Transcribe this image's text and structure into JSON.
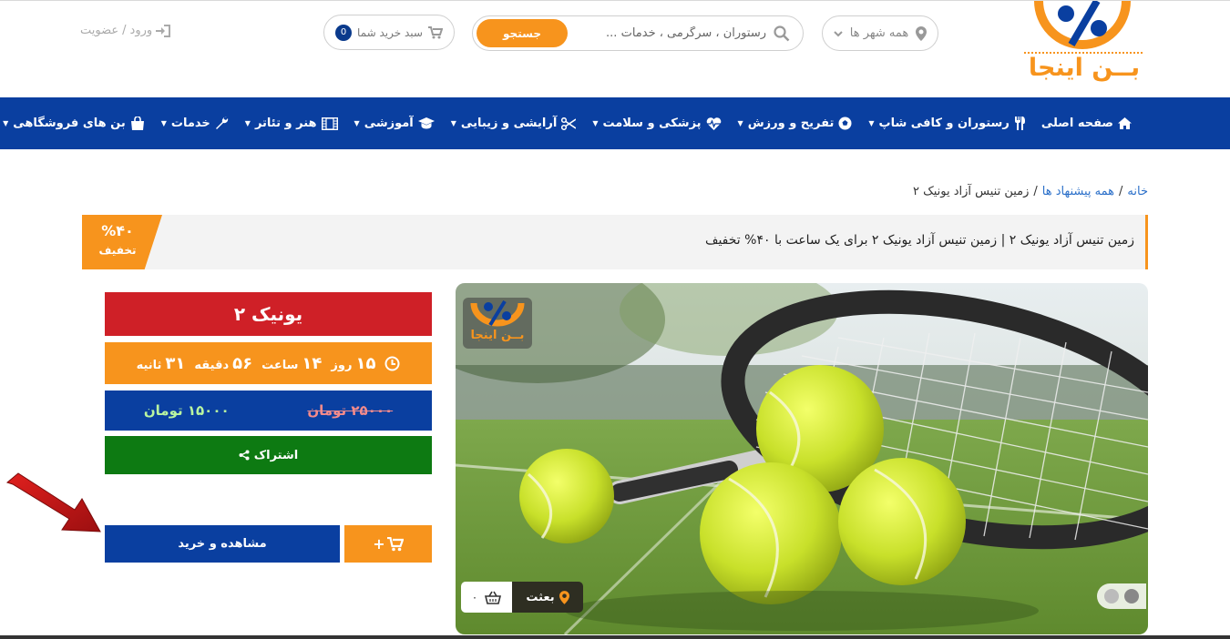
{
  "brand": {
    "name": "بــن اینجا",
    "accent": "#f7941d",
    "primary": "#0a3fa0"
  },
  "header": {
    "city_select": "همه شهر ها",
    "search_placeholder": "رستوران ، سرگرمی ، خدمات ...",
    "search_button": "جستجو",
    "cart_label": "سبد خرید شما",
    "cart_count": "0",
    "login_label": "ورود",
    "register_label": "عضویت"
  },
  "nav": {
    "items": [
      {
        "label": "صفحه اصلی",
        "icon": "home-icon"
      },
      {
        "label": "رستوران و کافی شاپ",
        "icon": "cutlery-icon"
      },
      {
        "label": "تفریح و ورزش",
        "icon": "soccer-ball-icon"
      },
      {
        "label": "پزشکی و سلامت",
        "icon": "heartbeat-icon"
      },
      {
        "label": "آرایشی و زیبایی",
        "icon": "scissors-icon"
      },
      {
        "label": "آموزشی",
        "icon": "graduation-cap-icon"
      },
      {
        "label": "هنر و تئاتر",
        "icon": "film-icon"
      },
      {
        "label": "خدمات",
        "icon": "wrench-icon"
      },
      {
        "label": "بن های فروشگاهی",
        "icon": "shopping-bag-icon"
      }
    ]
  },
  "breadcrumb": {
    "home": "خانه",
    "all_offers": "همه پیشنهاد ها",
    "current": "زمین تنیس آزاد یونیک ۲"
  },
  "deal": {
    "title": "زمین تنیس آزاد یونیک ۲ | زمین تنیس آزاد یونیک ۲ برای یک ساعت با ۴۰% تخفیف",
    "discount_percent": "%۴۰",
    "discount_label": "تخفیف",
    "name": "یونیک ۲",
    "countdown": {
      "days": "۱۵",
      "days_label": "روز",
      "hours": "۱۴",
      "hours_label": "ساعت",
      "minutes": "۵۶",
      "minutes_label": "دقیقه",
      "seconds": "۳۱",
      "seconds_label": "ثانیه"
    },
    "old_price": "۲۵۰۰۰ تومان",
    "new_price": "۱۵۰۰۰ تومان",
    "share_label": "اشتراک",
    "view_buy_label": "مشاهده و خرید",
    "add_cart_label": "+",
    "image": {
      "logo_text": "بــن اینجا",
      "location": "بعثت",
      "basket_count": "۰"
    }
  }
}
